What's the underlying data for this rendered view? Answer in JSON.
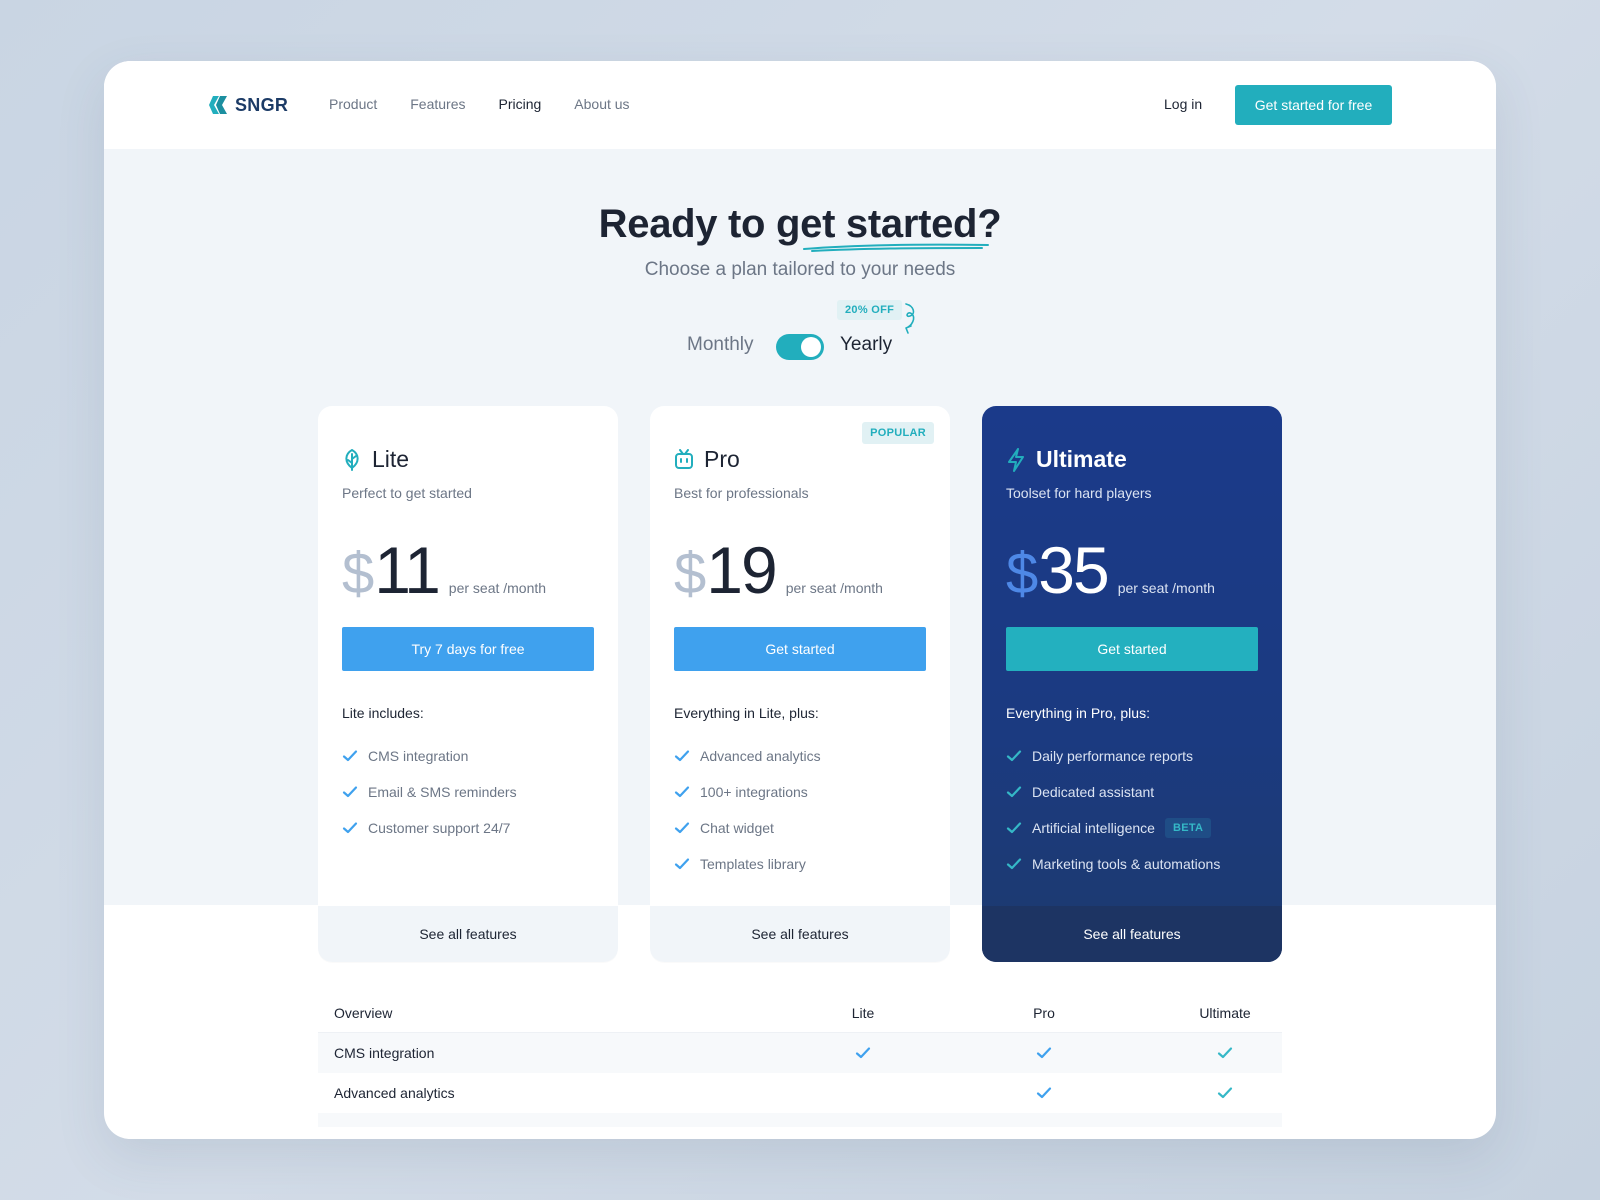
{
  "brand": {
    "name": "SNGR",
    "accent": "#22aebd",
    "dark": "#1b3a8a"
  },
  "nav": {
    "items": [
      "Product",
      "Features",
      "Pricing",
      "About us"
    ],
    "active": "Pricing",
    "login": "Log in",
    "cta": "Get started for free"
  },
  "hero": {
    "title_pre": "Ready to ",
    "title_hl": "get started",
    "title_post": "?",
    "subtitle": "Choose a plan tailored to your needs"
  },
  "billing": {
    "monthly": "Monthly",
    "yearly": "Yearly",
    "discount": "20% OFF",
    "selected": "Yearly"
  },
  "plans": [
    {
      "name": "Lite",
      "icon": "leaf-icon",
      "desc": "Perfect to get started",
      "currency": "$",
      "price": "11",
      "per": "per seat /month",
      "button": "Try 7 days for free",
      "includes_title": "Lite includes:",
      "features": [
        "CMS integration",
        "Email & SMS reminders",
        "Customer support 24/7"
      ],
      "see_all": "See all features"
    },
    {
      "name": "Pro",
      "icon": "tv-icon",
      "badge": "POPULAR",
      "desc": "Best for professionals",
      "currency": "$",
      "price": "19",
      "per": "per seat /month",
      "button": "Get started",
      "includes_title": "Everything in Lite, plus:",
      "features": [
        "Advanced analytics",
        "100+ integrations",
        "Chat widget",
        "Templates library"
      ],
      "see_all": "See all features"
    },
    {
      "name": "Ultimate",
      "icon": "lightning-icon",
      "desc": "Toolset for hard players",
      "currency": "$",
      "price": "35",
      "per": "per seat /month",
      "button": "Get started",
      "includes_title": "Everything in Pro, plus:",
      "features": [
        "Daily performance reports",
        "Dedicated assistant",
        "Artificial intelligence",
        "Marketing tools & automations"
      ],
      "feature_badge": "BETA",
      "see_all": "See all features"
    }
  ],
  "comparison": {
    "headers": [
      "Overview",
      "Lite",
      "Pro",
      "Ultimate"
    ],
    "rows": [
      {
        "feature": "CMS integration",
        "lite": true,
        "pro": true,
        "ultimate": true
      },
      {
        "feature": "Advanced analytics",
        "lite": false,
        "pro": true,
        "ultimate": true
      }
    ]
  }
}
